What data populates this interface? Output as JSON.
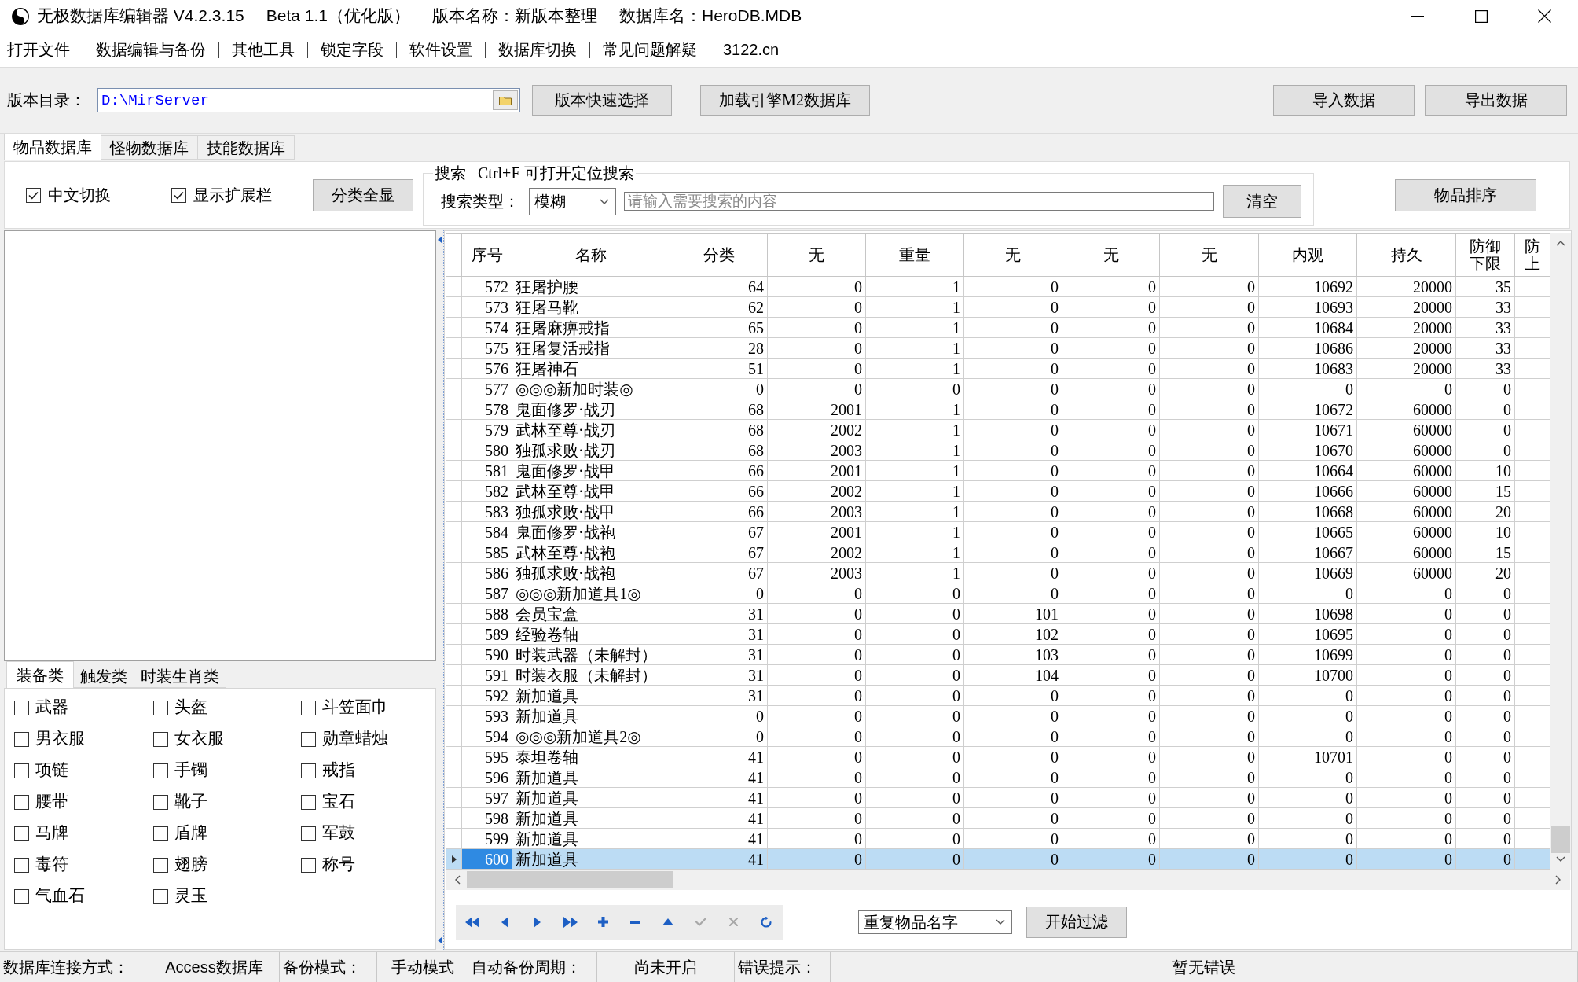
{
  "window": {
    "title_parts": [
      "无极数据库编辑器 V4.2.3.15",
      "Beta 1.1（优化版）",
      "版本名称：新版本整理",
      "数据库名：HeroDB.MDB"
    ]
  },
  "menu": [
    "打开文件",
    "数据编辑与备份",
    "其他工具",
    "锁定字段",
    "软件设置",
    "数据库切换",
    "常见问题解疑",
    "3122.cn"
  ],
  "version_dir": {
    "label": "版本目录：",
    "value": "D:\\MirServer",
    "buttons": [
      "版本快速选择",
      "加载引擎M2数据库"
    ]
  },
  "data_buttons": [
    "导入数据",
    "导出数据"
  ],
  "tabs": [
    {
      "label": "物品数据库",
      "selected": true
    },
    {
      "label": "怪物数据库",
      "selected": false
    },
    {
      "label": "技能数据库",
      "selected": false
    }
  ],
  "options": {
    "checkboxes": [
      {
        "label": "中文切换",
        "checked": true
      },
      {
        "label": "显示扩展栏",
        "checked": true
      }
    ],
    "show_all_button": "分类全显"
  },
  "search": {
    "legend": "搜索   Ctrl+F 可打开定位搜索",
    "type_label": "搜索类型：",
    "type_value": "模糊",
    "placeholder": "请输入需要搜索的内容",
    "clear_button": "清空"
  },
  "sort_button": "物品排序",
  "category_tabs": [
    {
      "label": "装备类",
      "selected": true
    },
    {
      "label": "触发类",
      "selected": false
    },
    {
      "label": "时装生肖类",
      "selected": false
    }
  ],
  "categories": [
    {
      "label": "武器",
      "checked": false
    },
    {
      "label": "头盔",
      "checked": false
    },
    {
      "label": "斗笠面巾",
      "checked": false
    },
    {
      "label": "男衣服",
      "checked": false
    },
    {
      "label": "女衣服",
      "checked": false
    },
    {
      "label": "勋章蜡烛",
      "checked": false
    },
    {
      "label": "项链",
      "checked": false
    },
    {
      "label": "手镯",
      "checked": false
    },
    {
      "label": "戒指",
      "checked": false
    },
    {
      "label": "腰带",
      "checked": false
    },
    {
      "label": "靴子",
      "checked": false
    },
    {
      "label": "宝石",
      "checked": false
    },
    {
      "label": "马牌",
      "checked": false
    },
    {
      "label": "盾牌",
      "checked": false
    },
    {
      "label": "军鼓",
      "checked": false
    },
    {
      "label": "毒符",
      "checked": false
    },
    {
      "label": "翅膀",
      "checked": false
    },
    {
      "label": "称号",
      "checked": false
    },
    {
      "label": "气血石",
      "checked": false
    },
    {
      "label": "灵玉",
      "checked": false
    }
  ],
  "table": {
    "columns": [
      {
        "lines": [
          "序号"
        ]
      },
      {
        "lines": [
          "名称"
        ]
      },
      {
        "lines": [
          "分类"
        ]
      },
      {
        "lines": [
          "无"
        ]
      },
      {
        "lines": [
          "重量"
        ]
      },
      {
        "lines": [
          "无"
        ]
      },
      {
        "lines": [
          "无"
        ]
      },
      {
        "lines": [
          "无"
        ]
      },
      {
        "lines": [
          "内观"
        ]
      },
      {
        "lines": [
          "持久"
        ]
      },
      {
        "lines": [
          "防御",
          "下限"
        ]
      },
      {
        "lines": [
          "防",
          "上"
        ]
      }
    ],
    "rows": [
      {
        "selected": false,
        "cells": [
          "572",
          "狂屠护腰",
          "64",
          "0",
          "1",
          "0",
          "0",
          "0",
          "10692",
          "20000",
          "35"
        ]
      },
      {
        "selected": false,
        "cells": [
          "573",
          "狂屠马靴",
          "62",
          "0",
          "1",
          "0",
          "0",
          "0",
          "10693",
          "20000",
          "33"
        ]
      },
      {
        "selected": false,
        "cells": [
          "574",
          "狂屠麻痹戒指",
          "65",
          "0",
          "1",
          "0",
          "0",
          "0",
          "10684",
          "20000",
          "33"
        ]
      },
      {
        "selected": false,
        "cells": [
          "575",
          "狂屠复活戒指",
          "28",
          "0",
          "1",
          "0",
          "0",
          "0",
          "10686",
          "20000",
          "33"
        ]
      },
      {
        "selected": false,
        "cells": [
          "576",
          "狂屠神石",
          "51",
          "0",
          "1",
          "0",
          "0",
          "0",
          "10683",
          "20000",
          "33"
        ]
      },
      {
        "selected": false,
        "cells": [
          "577",
          "◎◎◎新加时装◎",
          "0",
          "0",
          "0",
          "0",
          "0",
          "0",
          "0",
          "0",
          "0"
        ]
      },
      {
        "selected": false,
        "cells": [
          "578",
          "鬼面修罗·战刃",
          "68",
          "2001",
          "1",
          "0",
          "0",
          "0",
          "10672",
          "60000",
          "0"
        ]
      },
      {
        "selected": false,
        "cells": [
          "579",
          "武林至尊·战刃",
          "68",
          "2002",
          "1",
          "0",
          "0",
          "0",
          "10671",
          "60000",
          "0"
        ]
      },
      {
        "selected": false,
        "cells": [
          "580",
          "独孤求败·战刃",
          "68",
          "2003",
          "1",
          "0",
          "0",
          "0",
          "10670",
          "60000",
          "0"
        ]
      },
      {
        "selected": false,
        "cells": [
          "581",
          "鬼面修罗·战甲",
          "66",
          "2001",
          "1",
          "0",
          "0",
          "0",
          "10664",
          "60000",
          "10"
        ]
      },
      {
        "selected": false,
        "cells": [
          "582",
          "武林至尊·战甲",
          "66",
          "2002",
          "1",
          "0",
          "0",
          "0",
          "10666",
          "60000",
          "15"
        ]
      },
      {
        "selected": false,
        "cells": [
          "583",
          "独孤求败·战甲",
          "66",
          "2003",
          "1",
          "0",
          "0",
          "0",
          "10668",
          "60000",
          "20"
        ]
      },
      {
        "selected": false,
        "cells": [
          "584",
          "鬼面修罗·战袍",
          "67",
          "2001",
          "1",
          "0",
          "0",
          "0",
          "10665",
          "60000",
          "10"
        ]
      },
      {
        "selected": false,
        "cells": [
          "585",
          "武林至尊·战袍",
          "67",
          "2002",
          "1",
          "0",
          "0",
          "0",
          "10667",
          "60000",
          "15"
        ]
      },
      {
        "selected": false,
        "cells": [
          "586",
          "独孤求败·战袍",
          "67",
          "2003",
          "1",
          "0",
          "0",
          "0",
          "10669",
          "60000",
          "20"
        ]
      },
      {
        "selected": false,
        "cells": [
          "587",
          "◎◎◎新加道具1◎",
          "0",
          "0",
          "0",
          "0",
          "0",
          "0",
          "0",
          "0",
          "0"
        ]
      },
      {
        "selected": false,
        "cells": [
          "588",
          "会员宝盒",
          "31",
          "0",
          "0",
          "101",
          "0",
          "0",
          "10698",
          "0",
          "0"
        ]
      },
      {
        "selected": false,
        "cells": [
          "589",
          "经验卷轴",
          "31",
          "0",
          "0",
          "102",
          "0",
          "0",
          "10695",
          "0",
          "0"
        ]
      },
      {
        "selected": false,
        "cells": [
          "590",
          "时装武器（未解封）",
          "31",
          "0",
          "0",
          "103",
          "0",
          "0",
          "10699",
          "0",
          "0"
        ]
      },
      {
        "selected": false,
        "cells": [
          "591",
          "时装衣服（未解封）",
          "31",
          "0",
          "0",
          "104",
          "0",
          "0",
          "10700",
          "0",
          "0"
        ]
      },
      {
        "selected": false,
        "cells": [
          "592",
          "新加道具",
          "31",
          "0",
          "0",
          "0",
          "0",
          "0",
          "0",
          "0",
          "0"
        ]
      },
      {
        "selected": false,
        "cells": [
          "593",
          "新加道具",
          "0",
          "0",
          "0",
          "0",
          "0",
          "0",
          "0",
          "0",
          "0"
        ]
      },
      {
        "selected": false,
        "cells": [
          "594",
          "◎◎◎新加道具2◎",
          "0",
          "0",
          "0",
          "0",
          "0",
          "0",
          "0",
          "0",
          "0"
        ]
      },
      {
        "selected": false,
        "cells": [
          "595",
          "泰坦卷轴",
          "41",
          "0",
          "0",
          "0",
          "0",
          "0",
          "10701",
          "0",
          "0"
        ]
      },
      {
        "selected": false,
        "cells": [
          "596",
          "新加道具",
          "41",
          "0",
          "0",
          "0",
          "0",
          "0",
          "0",
          "0",
          "0"
        ]
      },
      {
        "selected": false,
        "cells": [
          "597",
          "新加道具",
          "41",
          "0",
          "0",
          "0",
          "0",
          "0",
          "0",
          "0",
          "0"
        ]
      },
      {
        "selected": false,
        "cells": [
          "598",
          "新加道具",
          "41",
          "0",
          "0",
          "0",
          "0",
          "0",
          "0",
          "0",
          "0"
        ]
      },
      {
        "selected": false,
        "cells": [
          "599",
          "新加道具",
          "41",
          "0",
          "0",
          "0",
          "0",
          "0",
          "0",
          "0",
          "0"
        ]
      },
      {
        "selected": true,
        "cells": [
          "600",
          "新加道具",
          "41",
          "0",
          "0",
          "0",
          "0",
          "0",
          "0",
          "0",
          "0"
        ]
      }
    ]
  },
  "navigator": [
    {
      "kind": "first",
      "disabled": false
    },
    {
      "kind": "prior",
      "disabled": false
    },
    {
      "kind": "next",
      "disabled": false
    },
    {
      "kind": "last",
      "disabled": false
    },
    {
      "kind": "insert",
      "disabled": false
    },
    {
      "kind": "delete",
      "disabled": false
    },
    {
      "kind": "edit",
      "disabled": false
    },
    {
      "kind": "post",
      "disabled": true
    },
    {
      "kind": "cancel",
      "disabled": true
    },
    {
      "kind": "refresh",
      "disabled": false
    }
  ],
  "filter": {
    "value": "重复物品名字",
    "button": "开始过滤"
  },
  "status_bar": [
    {
      "kind": "label",
      "text": "数据库连接方式："
    },
    {
      "kind": "value",
      "text": "Access数据库"
    },
    {
      "kind": "label",
      "text": "备份模式："
    },
    {
      "kind": "value",
      "text": "手动模式"
    },
    {
      "kind": "label",
      "text": "自动备份周期："
    },
    {
      "kind": "value",
      "text": "尚未开启"
    },
    {
      "kind": "label",
      "text": "错误提示："
    },
    {
      "kind": "value",
      "text": "暂无错误"
    }
  ]
}
